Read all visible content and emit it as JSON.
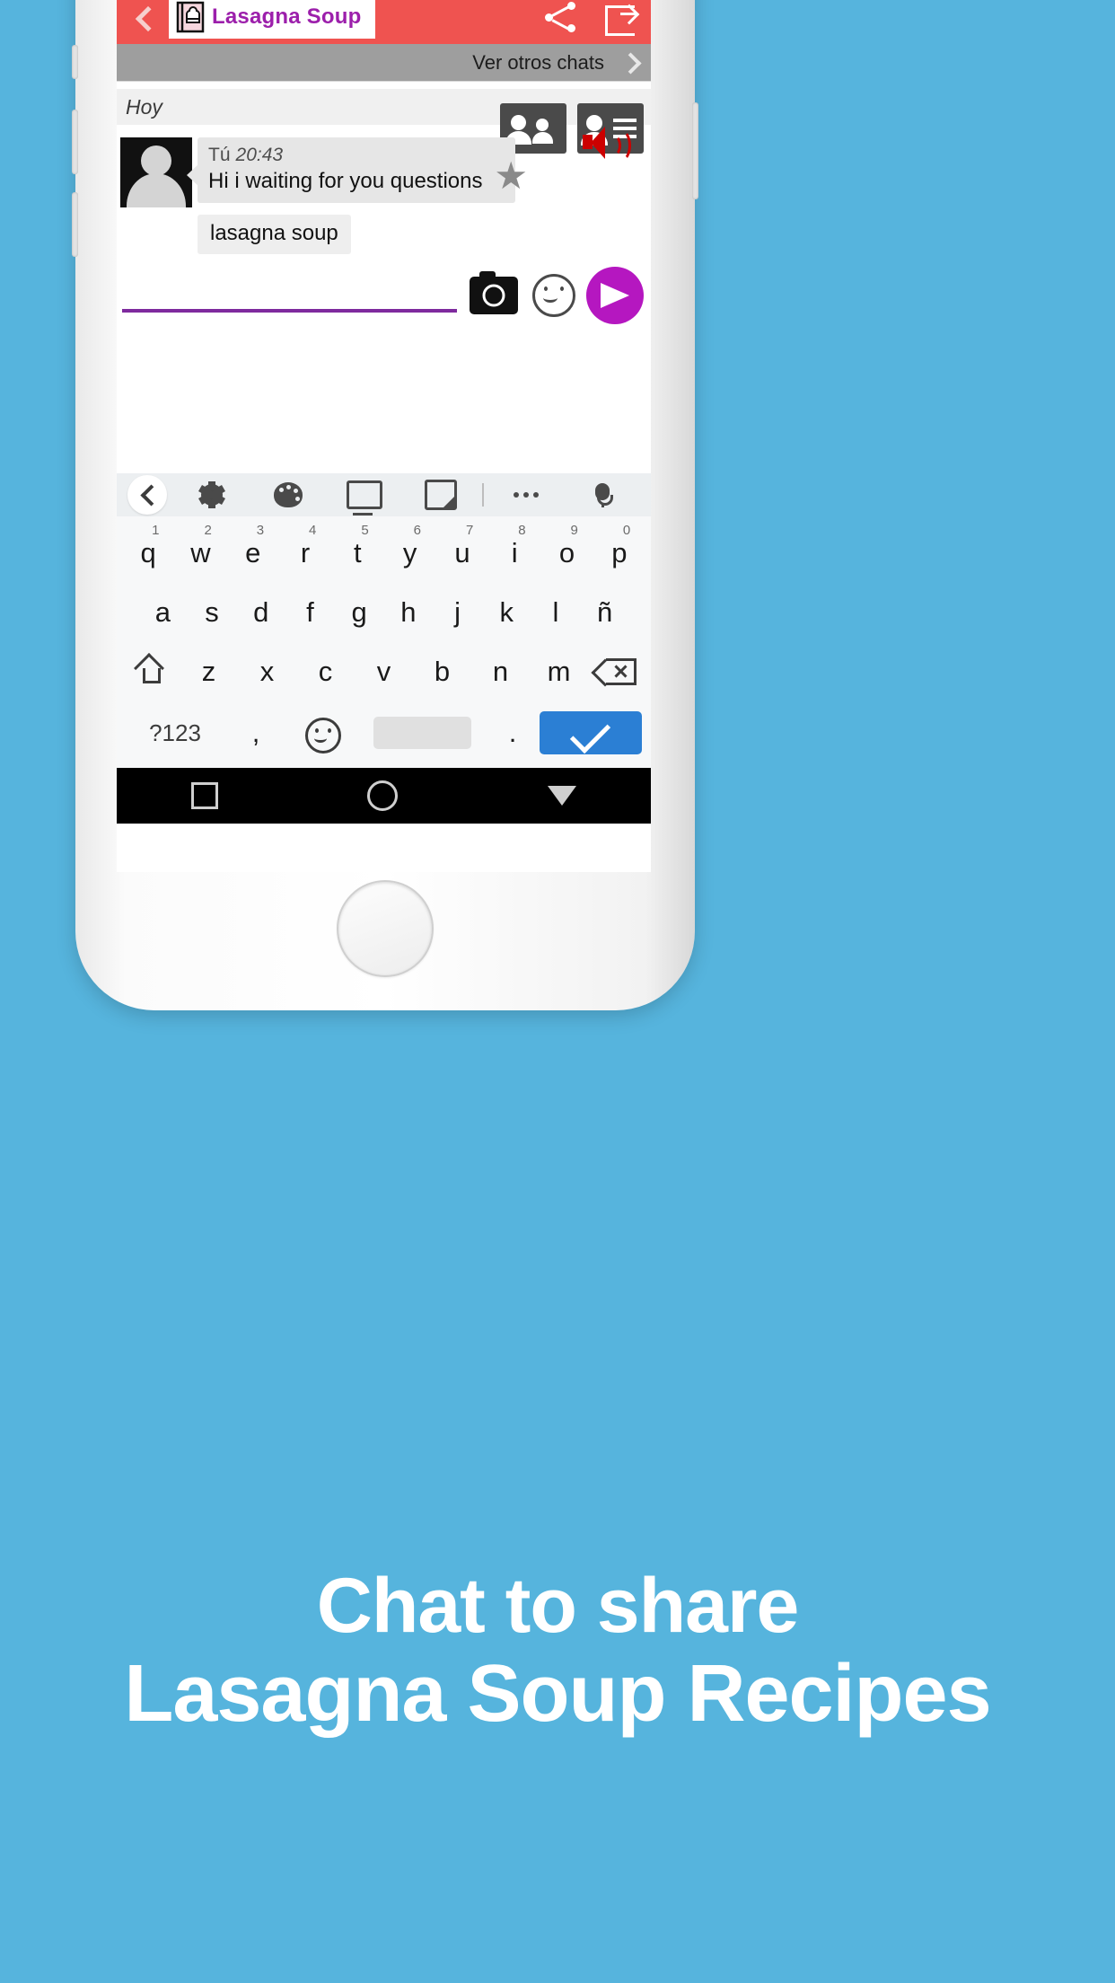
{
  "app": {
    "title": "Lasagna Soup",
    "header_bg": "#ef5350",
    "title_color": "#9c1fab",
    "icons": {
      "back": "back-chevron-icon",
      "logo": "chef-hat-book-icon",
      "share": "share-icon",
      "export": "export-icon"
    }
  },
  "other_chats": {
    "label": "Ver otros chats",
    "chevron": "chevron-right-icon"
  },
  "chat": {
    "day_divider": "Hoy",
    "group_buttons": [
      {
        "name": "group-people-icon"
      },
      {
        "name": "contact-list-icon"
      }
    ],
    "messages": [
      {
        "sender": "Tú",
        "time": "20:43",
        "text": "Hi i waiting for you questions",
        "starred": true,
        "star_glyph": "★"
      },
      {
        "text": "lasagna soup"
      }
    ],
    "speaker_icon": "volume-speaker-icon",
    "speaker_color": "#cc0000"
  },
  "composer": {
    "input_value": "",
    "input_placeholder": "",
    "underline_color": "#7e2a9e",
    "camera_icon": "camera-icon",
    "emoji_icon": "smiley-icon",
    "send_icon": "send-plane-icon",
    "send_bg": "#b517c0"
  },
  "keyboard": {
    "toolbar": [
      {
        "name": "keyboard-back-button",
        "icon": "chevron-left-icon"
      },
      {
        "name": "keyboard-settings",
        "icon": "gear-icon"
      },
      {
        "name": "keyboard-theme",
        "icon": "palette-icon"
      },
      {
        "name": "keyboard-layout",
        "icon": "keyboard-icon"
      },
      {
        "name": "keyboard-resize",
        "icon": "resize-icon"
      },
      {
        "name": "keyboard-more",
        "icon": "more-dots-icon"
      },
      {
        "name": "keyboard-voice",
        "icon": "microphone-icon"
      }
    ],
    "row1": [
      {
        "key": "q",
        "num": "1"
      },
      {
        "key": "w",
        "num": "2"
      },
      {
        "key": "e",
        "num": "3"
      },
      {
        "key": "r",
        "num": "4"
      },
      {
        "key": "t",
        "num": "5"
      },
      {
        "key": "y",
        "num": "6"
      },
      {
        "key": "u",
        "num": "7"
      },
      {
        "key": "i",
        "num": "8"
      },
      {
        "key": "o",
        "num": "9"
      },
      {
        "key": "p",
        "num": "0"
      }
    ],
    "row2": [
      {
        "key": "a"
      },
      {
        "key": "s"
      },
      {
        "key": "d"
      },
      {
        "key": "f"
      },
      {
        "key": "g"
      },
      {
        "key": "h"
      },
      {
        "key": "j"
      },
      {
        "key": "k"
      },
      {
        "key": "l"
      },
      {
        "key": "ñ"
      }
    ],
    "row3": [
      {
        "key": "z"
      },
      {
        "key": "x"
      },
      {
        "key": "c"
      },
      {
        "key": "v"
      },
      {
        "key": "b"
      },
      {
        "key": "n"
      },
      {
        "key": "m"
      }
    ],
    "shift_label": "shift-icon",
    "backspace_label": "backspace-icon",
    "row4": {
      "symbols": "?123",
      "comma": ",",
      "emoji": "smiley-icon",
      "space": "",
      "period": ".",
      "enter": "check-icon",
      "enter_bg": "#2b7fd4"
    }
  },
  "navbar": {
    "recent": "square-icon",
    "home": "circle-icon",
    "back": "triangle-back-icon"
  },
  "caption": {
    "line1": "Chat to share",
    "line2": "Lasagna Soup Recipes"
  },
  "background_color": "#56b4dd"
}
